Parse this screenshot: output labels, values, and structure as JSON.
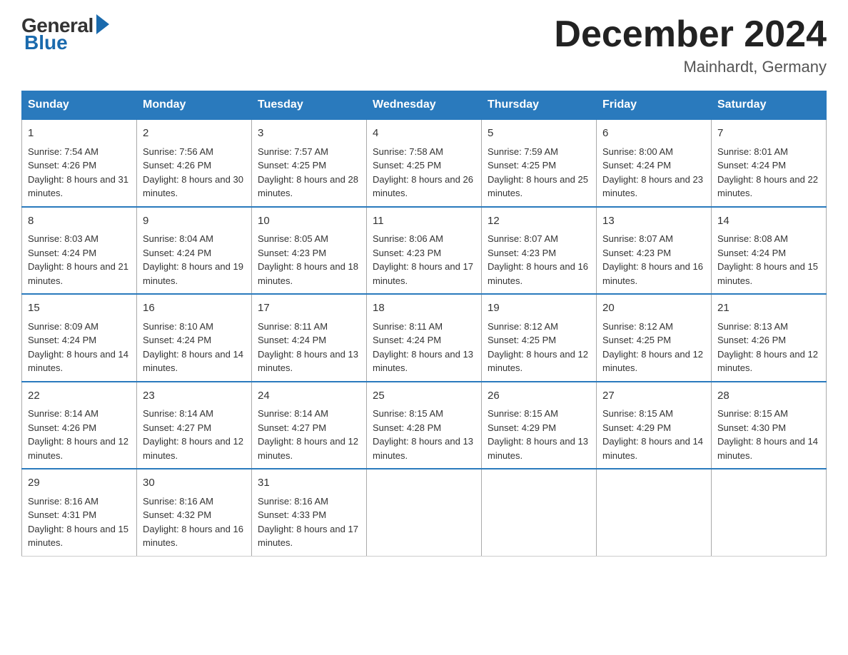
{
  "header": {
    "logo_general": "General",
    "logo_blue": "Blue",
    "title": "December 2024",
    "location": "Mainhardt, Germany"
  },
  "days_of_week": [
    "Sunday",
    "Monday",
    "Tuesday",
    "Wednesday",
    "Thursday",
    "Friday",
    "Saturday"
  ],
  "weeks": [
    [
      {
        "day": "1",
        "sunrise": "7:54 AM",
        "sunset": "4:26 PM",
        "daylight": "8 hours and 31 minutes."
      },
      {
        "day": "2",
        "sunrise": "7:56 AM",
        "sunset": "4:26 PM",
        "daylight": "8 hours and 30 minutes."
      },
      {
        "day": "3",
        "sunrise": "7:57 AM",
        "sunset": "4:25 PM",
        "daylight": "8 hours and 28 minutes."
      },
      {
        "day": "4",
        "sunrise": "7:58 AM",
        "sunset": "4:25 PM",
        "daylight": "8 hours and 26 minutes."
      },
      {
        "day": "5",
        "sunrise": "7:59 AM",
        "sunset": "4:25 PM",
        "daylight": "8 hours and 25 minutes."
      },
      {
        "day": "6",
        "sunrise": "8:00 AM",
        "sunset": "4:24 PM",
        "daylight": "8 hours and 23 minutes."
      },
      {
        "day": "7",
        "sunrise": "8:01 AM",
        "sunset": "4:24 PM",
        "daylight": "8 hours and 22 minutes."
      }
    ],
    [
      {
        "day": "8",
        "sunrise": "8:03 AM",
        "sunset": "4:24 PM",
        "daylight": "8 hours and 21 minutes."
      },
      {
        "day": "9",
        "sunrise": "8:04 AM",
        "sunset": "4:24 PM",
        "daylight": "8 hours and 19 minutes."
      },
      {
        "day": "10",
        "sunrise": "8:05 AM",
        "sunset": "4:23 PM",
        "daylight": "8 hours and 18 minutes."
      },
      {
        "day": "11",
        "sunrise": "8:06 AM",
        "sunset": "4:23 PM",
        "daylight": "8 hours and 17 minutes."
      },
      {
        "day": "12",
        "sunrise": "8:07 AM",
        "sunset": "4:23 PM",
        "daylight": "8 hours and 16 minutes."
      },
      {
        "day": "13",
        "sunrise": "8:07 AM",
        "sunset": "4:23 PM",
        "daylight": "8 hours and 16 minutes."
      },
      {
        "day": "14",
        "sunrise": "8:08 AM",
        "sunset": "4:24 PM",
        "daylight": "8 hours and 15 minutes."
      }
    ],
    [
      {
        "day": "15",
        "sunrise": "8:09 AM",
        "sunset": "4:24 PM",
        "daylight": "8 hours and 14 minutes."
      },
      {
        "day": "16",
        "sunrise": "8:10 AM",
        "sunset": "4:24 PM",
        "daylight": "8 hours and 14 minutes."
      },
      {
        "day": "17",
        "sunrise": "8:11 AM",
        "sunset": "4:24 PM",
        "daylight": "8 hours and 13 minutes."
      },
      {
        "day": "18",
        "sunrise": "8:11 AM",
        "sunset": "4:24 PM",
        "daylight": "8 hours and 13 minutes."
      },
      {
        "day": "19",
        "sunrise": "8:12 AM",
        "sunset": "4:25 PM",
        "daylight": "8 hours and 12 minutes."
      },
      {
        "day": "20",
        "sunrise": "8:12 AM",
        "sunset": "4:25 PM",
        "daylight": "8 hours and 12 minutes."
      },
      {
        "day": "21",
        "sunrise": "8:13 AM",
        "sunset": "4:26 PM",
        "daylight": "8 hours and 12 minutes."
      }
    ],
    [
      {
        "day": "22",
        "sunrise": "8:14 AM",
        "sunset": "4:26 PM",
        "daylight": "8 hours and 12 minutes."
      },
      {
        "day": "23",
        "sunrise": "8:14 AM",
        "sunset": "4:27 PM",
        "daylight": "8 hours and 12 minutes."
      },
      {
        "day": "24",
        "sunrise": "8:14 AM",
        "sunset": "4:27 PM",
        "daylight": "8 hours and 12 minutes."
      },
      {
        "day": "25",
        "sunrise": "8:15 AM",
        "sunset": "4:28 PM",
        "daylight": "8 hours and 13 minutes."
      },
      {
        "day": "26",
        "sunrise": "8:15 AM",
        "sunset": "4:29 PM",
        "daylight": "8 hours and 13 minutes."
      },
      {
        "day": "27",
        "sunrise": "8:15 AM",
        "sunset": "4:29 PM",
        "daylight": "8 hours and 14 minutes."
      },
      {
        "day": "28",
        "sunrise": "8:15 AM",
        "sunset": "4:30 PM",
        "daylight": "8 hours and 14 minutes."
      }
    ],
    [
      {
        "day": "29",
        "sunrise": "8:16 AM",
        "sunset": "4:31 PM",
        "daylight": "8 hours and 15 minutes."
      },
      {
        "day": "30",
        "sunrise": "8:16 AM",
        "sunset": "4:32 PM",
        "daylight": "8 hours and 16 minutes."
      },
      {
        "day": "31",
        "sunrise": "8:16 AM",
        "sunset": "4:33 PM",
        "daylight": "8 hours and 17 minutes."
      },
      null,
      null,
      null,
      null
    ]
  ]
}
